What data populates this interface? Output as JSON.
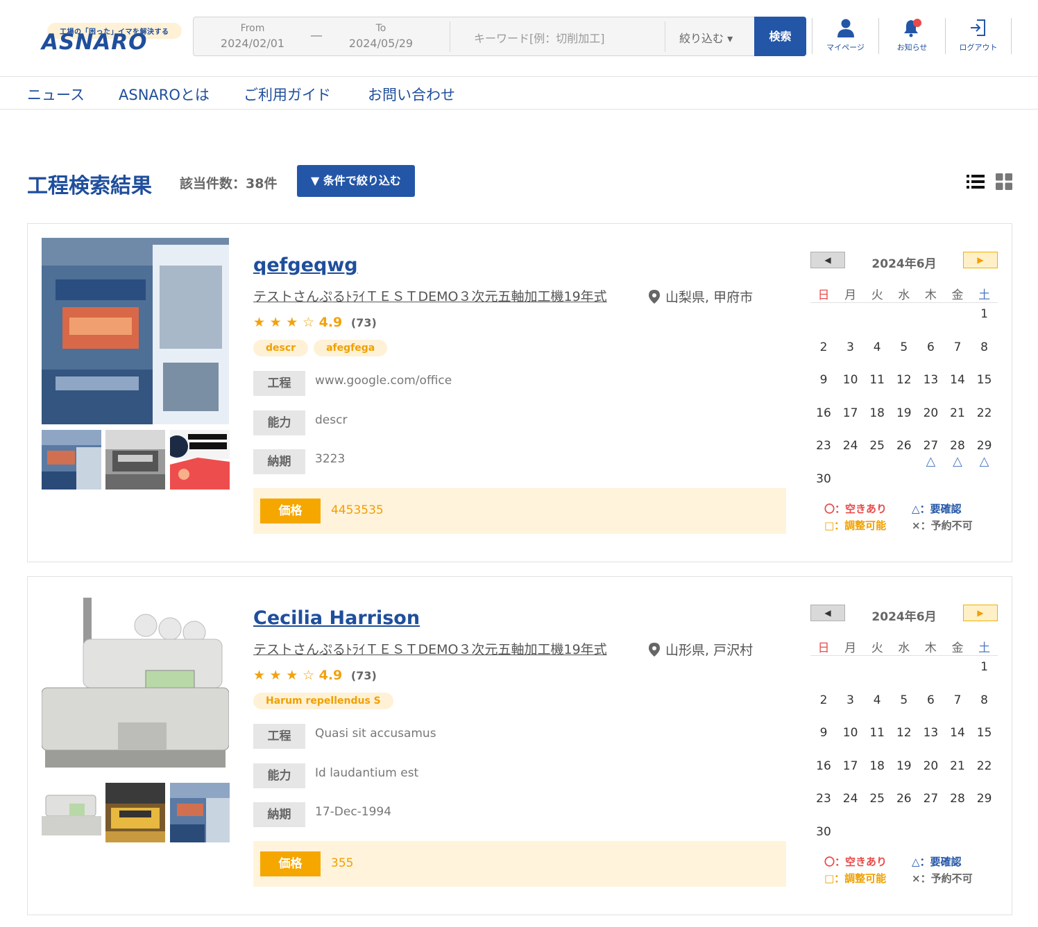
{
  "logo": {
    "tagline": "工場の「困った」イマを解決する",
    "wordmark": "ASNARO"
  },
  "search": {
    "from_label": "From",
    "from_value": "2024/02/01",
    "dash": "—",
    "to_label": "To",
    "to_value": "2024/05/29",
    "keyword_placeholder": "キーワード[例：切削加工]",
    "narrow_label": "絞り込む ▾",
    "search_button": "検索"
  },
  "header_nav": {
    "mypage": "マイページ",
    "notice": "お知らせ",
    "logout": "ログアウト"
  },
  "subnav": [
    "ニュース",
    "ASNAROとは",
    "ご利用ガイド",
    "お問い合わせ"
  ],
  "results": {
    "title": "工程検索結果",
    "count": "該当件数：38件",
    "filter_button": "▼ 条件で絞り込む"
  },
  "weekdays": [
    "日",
    "月",
    "火",
    "水",
    "木",
    "金",
    "土"
  ],
  "legend": {
    "available": "〇：空きあり",
    "confirm": "△：要確認",
    "adjustable": "□：調整可能",
    "unavailable": "×：予約不可"
  },
  "labels": {
    "process": "工程",
    "capacity": "能力",
    "delivery": "納期",
    "price": "価格"
  },
  "colors": {
    "brand": "#1f4e9c",
    "button": "#2356a7",
    "accent": "#f5a700",
    "sunday": "#e84a4a",
    "saturday": "#4a78c0"
  },
  "cards": [
    {
      "name": "qefgeqwg",
      "subtitle": "テストさんぷるﾄﾗｲＴＥＳＴDEMO３次元五軸加工機19年式",
      "location": "山梨県, 甲府市",
      "stars": "★ ★ ★ ☆",
      "rating": "4.9",
      "reviews": "(73)",
      "tags": [
        "descr",
        "afegfega"
      ],
      "process": "www.google.com/office",
      "capacity": "descr",
      "delivery": "3223",
      "price": "4453535",
      "calendar": {
        "month": "2024年6月",
        "prev": "◀",
        "next": "▶",
        "marks": {
          "27": "△",
          "28": "△",
          "29": "△"
        }
      }
    },
    {
      "name": "Cecilia Harrison",
      "subtitle": "テストさんぷるﾄﾗｲＴＥＳＴDEMO３次元五軸加工機19年式",
      "location": "山形県, 戸沢村",
      "stars": "★ ★ ★ ☆",
      "rating": "4.9",
      "reviews": "(73)",
      "tags": [
        "Harum repellendus S"
      ],
      "process": "Quasi sit accusamus",
      "capacity": "Id laudantium est",
      "delivery": "17-Dec-1994",
      "price": "355",
      "calendar": {
        "month": "2024年6月",
        "prev": "◀",
        "next": "▶",
        "marks": {}
      }
    }
  ]
}
